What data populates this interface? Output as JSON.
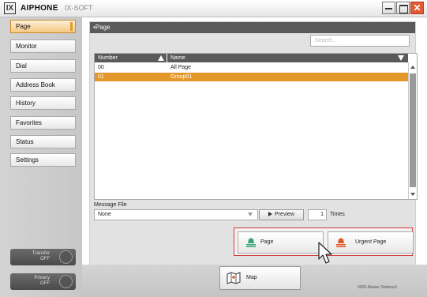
{
  "window": {
    "logo": "IX",
    "brand": "AIPHONE",
    "suffix": "IX-SOFT",
    "controls": [
      "minimize",
      "maximize",
      "close"
    ],
    "close_glyph": "✕"
  },
  "sidebar": {
    "items": [
      {
        "label": "Page",
        "active": true
      },
      {
        "label": "Monitor"
      },
      {
        "label": "Dial"
      },
      {
        "label": "Address Book"
      },
      {
        "label": "History"
      },
      {
        "label": "Favorites"
      },
      {
        "label": "Status"
      },
      {
        "label": "Settings"
      }
    ],
    "toggles": [
      {
        "label": "Transfer",
        "state": "OFF"
      },
      {
        "label": "Privacy",
        "state": "OFF"
      }
    ]
  },
  "main": {
    "header": "▪Page",
    "search": {
      "placeholder": "Search..."
    },
    "table": {
      "columns": [
        "Number",
        "Name"
      ],
      "rows": [
        {
          "number": "00",
          "name": "All Page",
          "selected": false
        },
        {
          "number": "01",
          "name": "Group01",
          "selected": true
        }
      ]
    },
    "message_file": {
      "label": "Message File",
      "value": "None",
      "preview_label": "Preview",
      "times_value": "1",
      "times_label": "Times"
    },
    "page_buttons": {
      "page_label": "Page",
      "urgent_label": "Urgent Page"
    }
  },
  "footer": {
    "map_label": "Map",
    "status_text": "0005-Master Stations1"
  },
  "colors": {
    "selected_row": "#e4982b",
    "active_nav": "#f4c880",
    "header_dark": "#5a5a5a",
    "page_highlight": "#d23a3a",
    "close_button": "#e05a33"
  },
  "icons": [
    "page-bell-icon",
    "urgent-page-bell-icon",
    "map-icon",
    "mouse-cursor-icon",
    "sort-asc-icon",
    "sort-desc-icon"
  ]
}
